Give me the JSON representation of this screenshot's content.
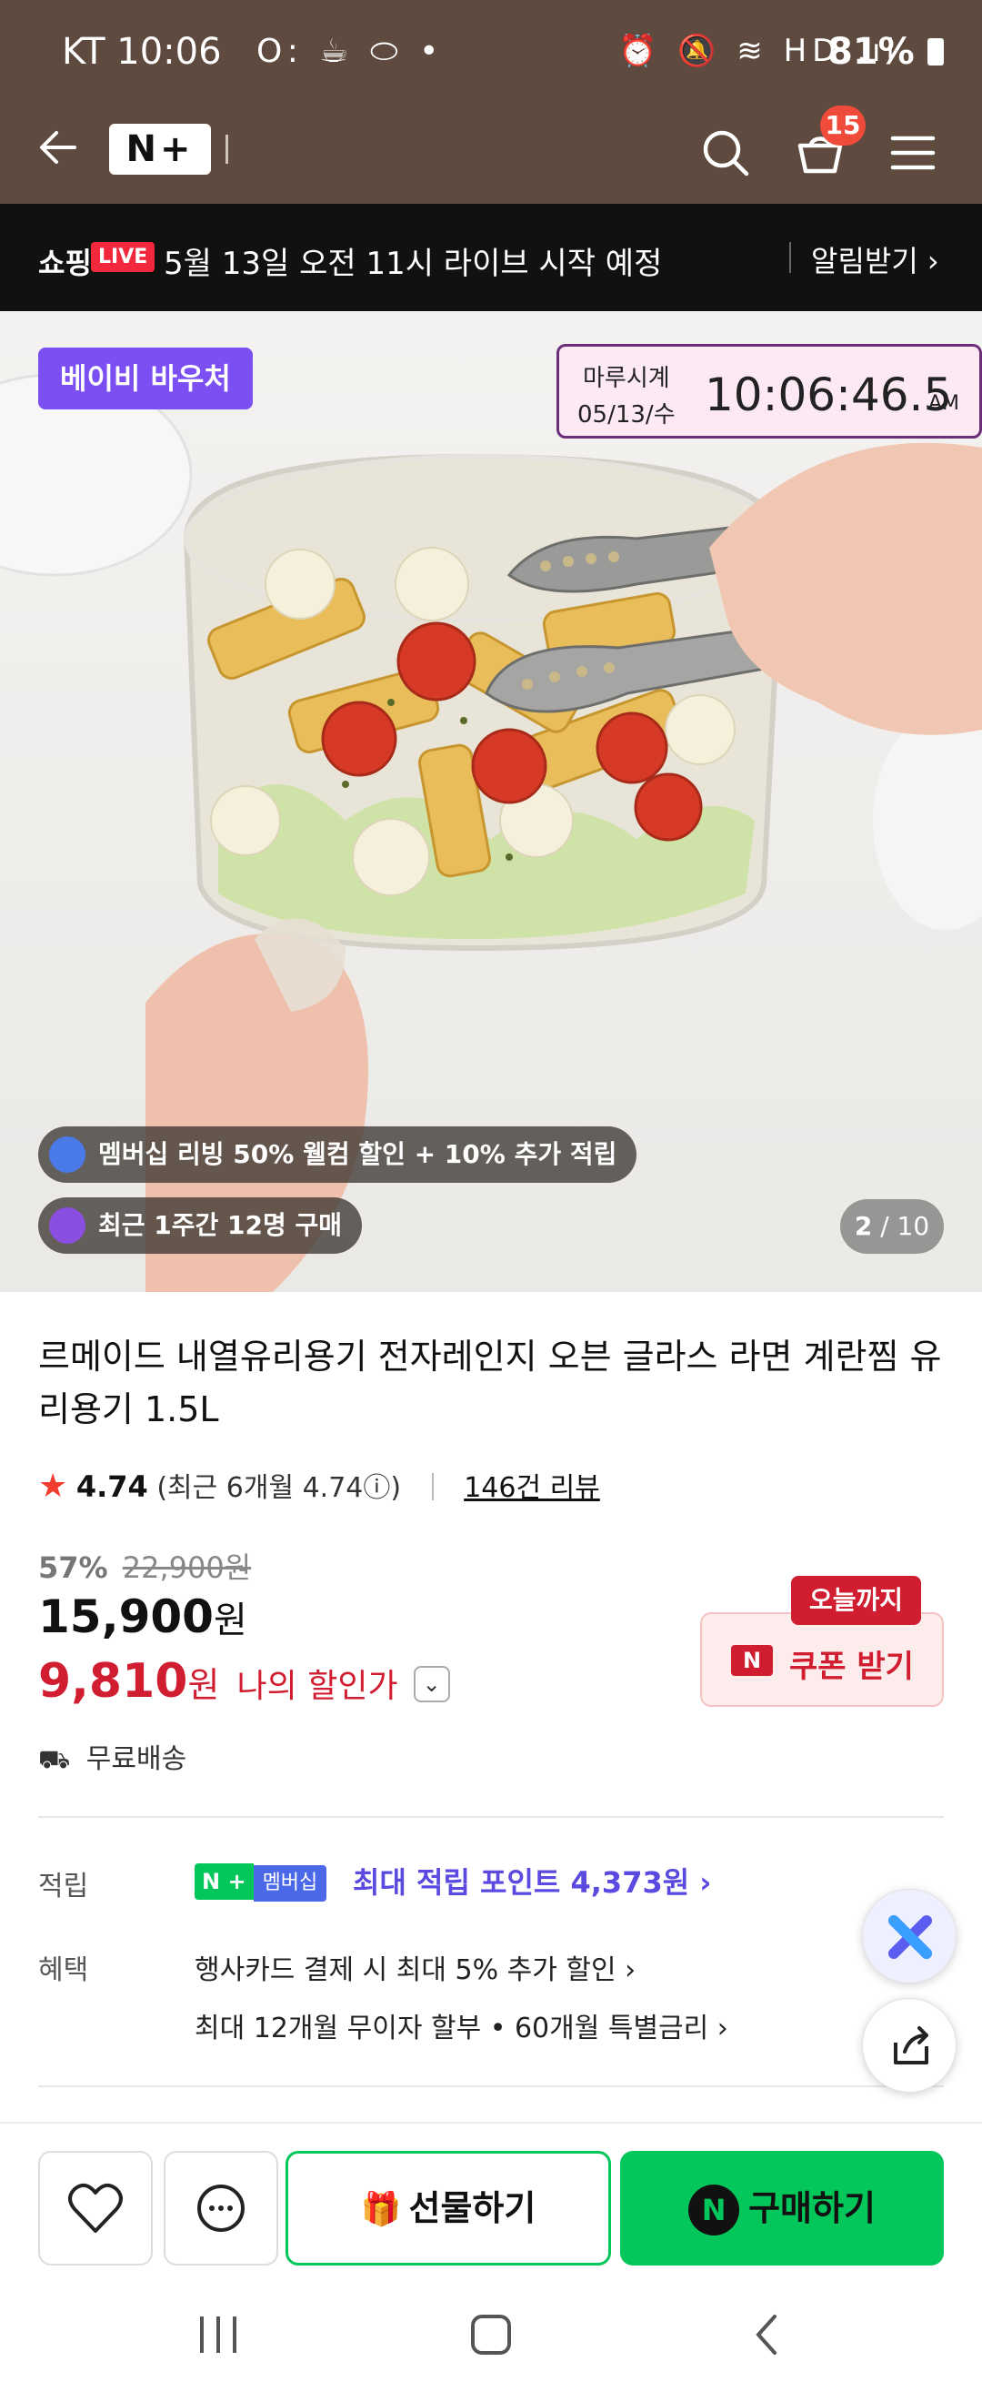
{
  "status_bar": {
    "carrier_time": "KT 10:06",
    "left_icons": "O: ☕ ⬭ •",
    "right_icons": "⏰ 🔕 ≋ HD .ıl",
    "battery": "81%"
  },
  "header": {
    "logo": "N+",
    "cart_count": "15"
  },
  "live_banner": {
    "label": "쇼핑",
    "badge": "LIVE",
    "message": "5월 13일 오전 11시 라이브 시작 예정",
    "notify": "알림받기 ›"
  },
  "gallery": {
    "voucher": "베이비 바우처",
    "clock_brand": "마루시계",
    "clock_date": "05/13/수",
    "clock_time": "10:06:46.5",
    "clock_ampm": "AM",
    "membership_pill": "멤버십 리빙 50% 웰컴 할인 + 10% 추가 적립",
    "recent_pill": "최근 1주간 12명 구매",
    "counter_current": "2",
    "counter_total": "/ 10"
  },
  "product": {
    "title": "르메이드 내열유리용기 전자레인지 오븐 글라스 라면 계란찜 유리용기 1.5L",
    "rating": "4.74",
    "recent_rating": "(최근 6개월 4.74ⓘ)",
    "review_count": "146건 리뷰",
    "discount_pct": "57%",
    "original_price": "22,900원",
    "price": "15,900",
    "price_unit": "원",
    "my_price": "9,810",
    "my_price_unit": "원",
    "my_price_label": "나의 할인가",
    "today_badge": "오늘까지",
    "coupon_label": "쿠폰 받기",
    "coupon_icon": "N",
    "shipping": "무료배송"
  },
  "benefits": {
    "points_label": "적립",
    "npoint_badge": "N +",
    "membership_badge": "멤버십",
    "points_text": "최대 적립 포인트 4,373원 ›",
    "benefit_label": "혜택",
    "benefit_1": "행사카드 결제 시 최대 5% 추가 할인 ›",
    "benefit_2": "최대 12개월 무이자 할부 • 60개월 특별금리 ›"
  },
  "bottom_bar": {
    "gift_label": "선물하기",
    "buy_label": "구매하기",
    "buy_icon": "N"
  },
  "colors": {
    "header_bg": "#5e4a3e",
    "naver_green": "#03c75a",
    "sale_red": "#d11d30",
    "voucher_purple": "#7c4ff2"
  }
}
